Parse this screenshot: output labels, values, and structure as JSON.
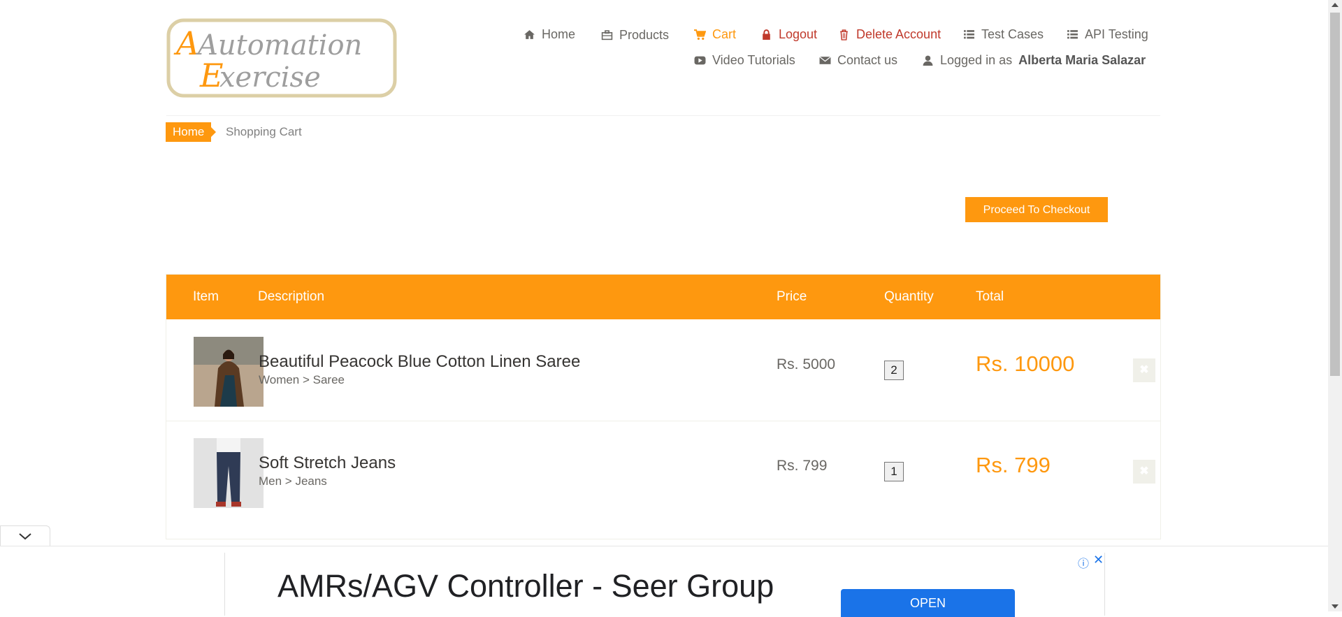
{
  "logo": {
    "line1": "Automation",
    "line2": "Exercise"
  },
  "nav": {
    "home": "Home",
    "products": "Products",
    "cart": "Cart",
    "logout": "Logout",
    "delete_account": "Delete Account",
    "test_cases": "Test Cases",
    "api_testing": "API Testing",
    "video_tutorials": "Video Tutorials",
    "contact_us": "Contact us",
    "logged_in_prefix": "Logged in as",
    "user_name": "Alberta Maria Salazar"
  },
  "breadcrumb": {
    "home": "Home",
    "current": "Shopping Cart"
  },
  "checkout_label": "Proceed To Checkout",
  "table": {
    "headers": {
      "item": "Item",
      "description": "Description",
      "price": "Price",
      "quantity": "Quantity",
      "total": "Total"
    },
    "rows": [
      {
        "name": "Beautiful Peacock Blue Cotton Linen Saree",
        "category": "Women > Saree",
        "price": "Rs. 5000",
        "quantity": "2",
        "total": "Rs. 10000"
      },
      {
        "name": "Soft Stretch Jeans",
        "category": "Men > Jeans",
        "price": "Rs. 799",
        "quantity": "1",
        "total": "Rs. 799"
      }
    ]
  },
  "ad": {
    "title": "AMRs/AGV Controller - Seer Group",
    "button": "OPEN"
  },
  "colors": {
    "accent": "#FE980F",
    "danger": "#C0392B",
    "ad_button": "#1a73e8"
  },
  "icons": {
    "home": "home-icon",
    "products": "briefcase-icon",
    "cart": "shopping-cart-icon",
    "logout": "lock-icon",
    "delete": "trash-icon",
    "test_cases": "list-icon",
    "api": "list-icon",
    "video": "youtube-play-icon",
    "contact": "envelope-icon",
    "user": "user-icon",
    "remove": "times-icon",
    "collapse": "chevron-down-icon"
  }
}
